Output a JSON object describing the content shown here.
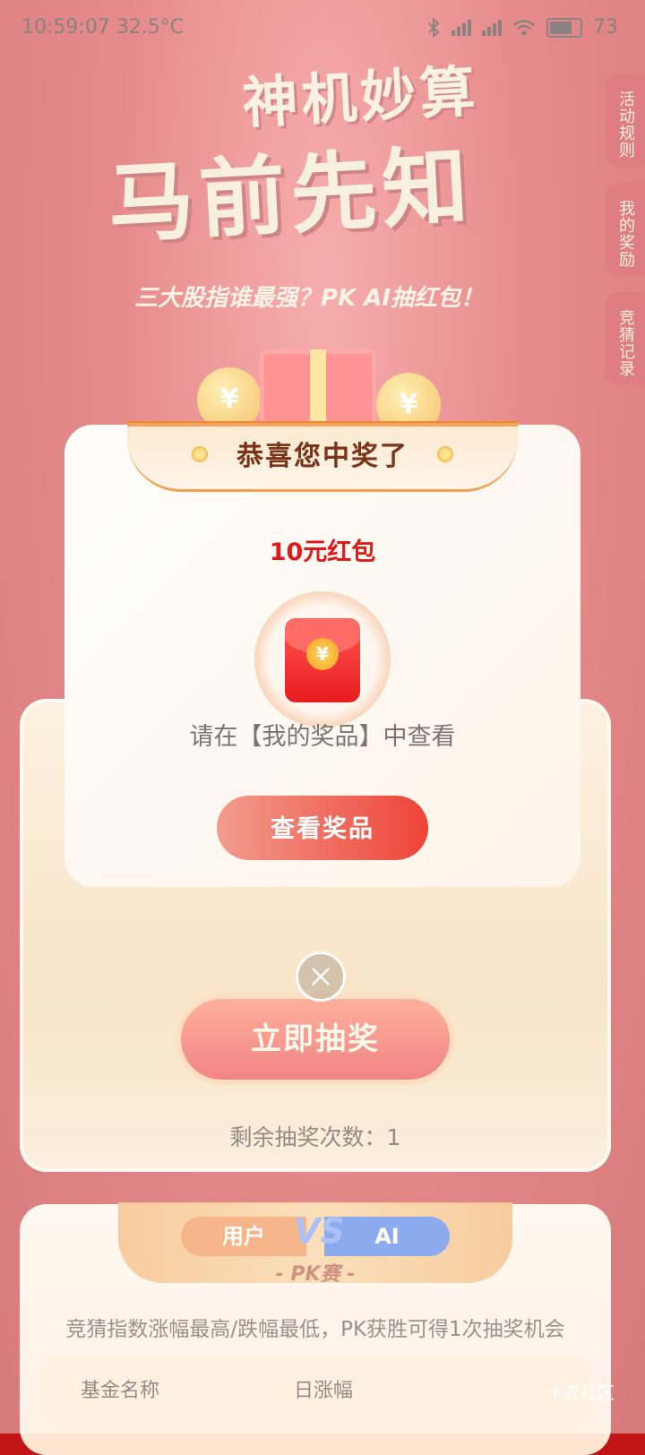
{
  "status_bar": {
    "time": "10:59:07",
    "temperature": "32.5°C",
    "battery": "73",
    "icons": [
      "bluetooth-icon",
      "signal-icon",
      "signal-icon",
      "wifi-icon",
      "battery-icon"
    ]
  },
  "hero": {
    "title_line1": "神机妙算",
    "title_line2": "马前先知",
    "subtitle": "三大股指谁最强？PK AI抽红包！",
    "coin_symbol": "¥"
  },
  "side_tabs": [
    {
      "label": "活动规则"
    },
    {
      "label": "我的奖励"
    },
    {
      "label": "竞猜记录"
    }
  ],
  "lottery": {
    "draw_button": "立即抽奖",
    "remaining_label": "剩余抽奖次数：1"
  },
  "pk": {
    "user_label": "用户",
    "vs_label": "VS",
    "ai_label": "AI",
    "title": "- PK赛 -",
    "description": "竞猜指数涨幅最高/跌幅最低，PK获胜可得1次抽奖机会",
    "table_headers": [
      "基金名称",
      "日涨幅"
    ]
  },
  "modal": {
    "title": "恭喜您中奖了",
    "prize": "10元红包",
    "coin_symbol": "¥",
    "hint": "请在【我的奖品】中查看",
    "view_button": "查看奖品"
  },
  "watermark": "卡农社区",
  "colors": {
    "brand_red": "#d22d2d",
    "prize_red": "#e01919",
    "button_gradient_end": "#ee4437"
  }
}
